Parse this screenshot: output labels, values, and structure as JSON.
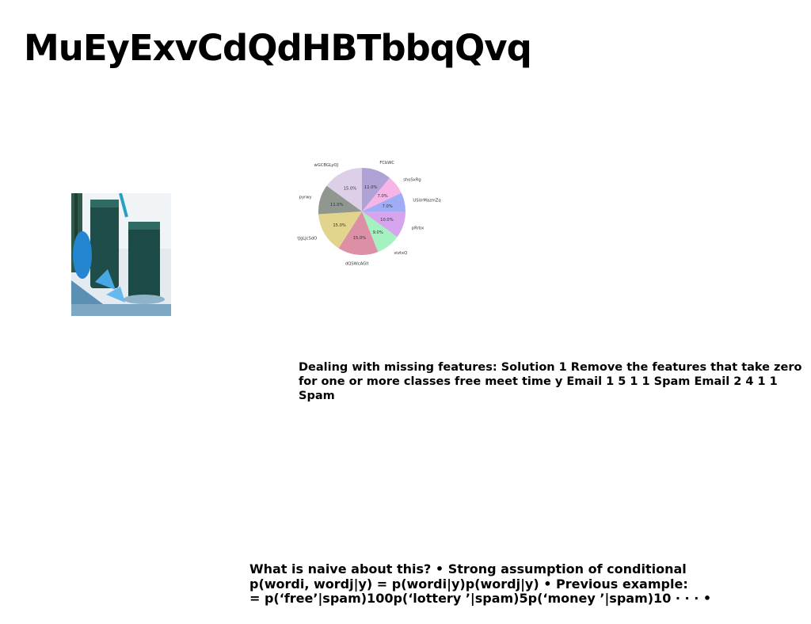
{
  "slide": {
    "title": "MuEyExvCdQdHBTbbqQvq",
    "paragraph1": "Dealing with missing features: Solution 1 Remove the features that take zero for one or more classes free meet time y Email 1 5 1 1 Spam Email 2 4 1 1 Spam",
    "paragraph2_lines": [
      "What is naive about this? • Strong assumption of conditional",
      "p(wordi, wordj|y) = p(wordi|y)p(wordj|y) • Previous example:",
      "= p(‘free’|spam)100p(‘lottery ’|spam)5p(‘money ’|spam)10 · · · •"
    ]
  },
  "photo": {
    "colors": {
      "bg": "#dfe7ee",
      "glass": "#1d4f4a",
      "lime": "#2b8fd6",
      "table": "#6d9fbf"
    }
  },
  "chart_data": {
    "type": "pie",
    "categories": [
      "FCbWC",
      "shoSxRg",
      "USUrMazmZq",
      "pRrbx",
      "stztxQ",
      "dQSWcAGlt",
      "tJgLJcSdO",
      "pyrwy",
      "wGCBGLyOJ"
    ],
    "values": [
      11.0,
      7.0,
      7.0,
      10.0,
      9.0,
      15.0,
      15.0,
      11.0,
      15.0
    ],
    "labels": [
      "11.0%",
      "7.0%",
      "7.0%",
      "10.0%",
      "9.0%",
      "15.0%",
      "15.0%",
      "11.0%",
      "15.0%"
    ],
    "colors": [
      "#b0a2d6",
      "#f7b4e6",
      "#a1acf7",
      "#d6a5ee",
      "#a5f2c0",
      "#dd8fa6",
      "#e2d48d",
      "#8f978f",
      "#ddcfe8"
    ],
    "start_angle": 90,
    "direction": "clockwise",
    "title": "",
    "legend": "none"
  }
}
